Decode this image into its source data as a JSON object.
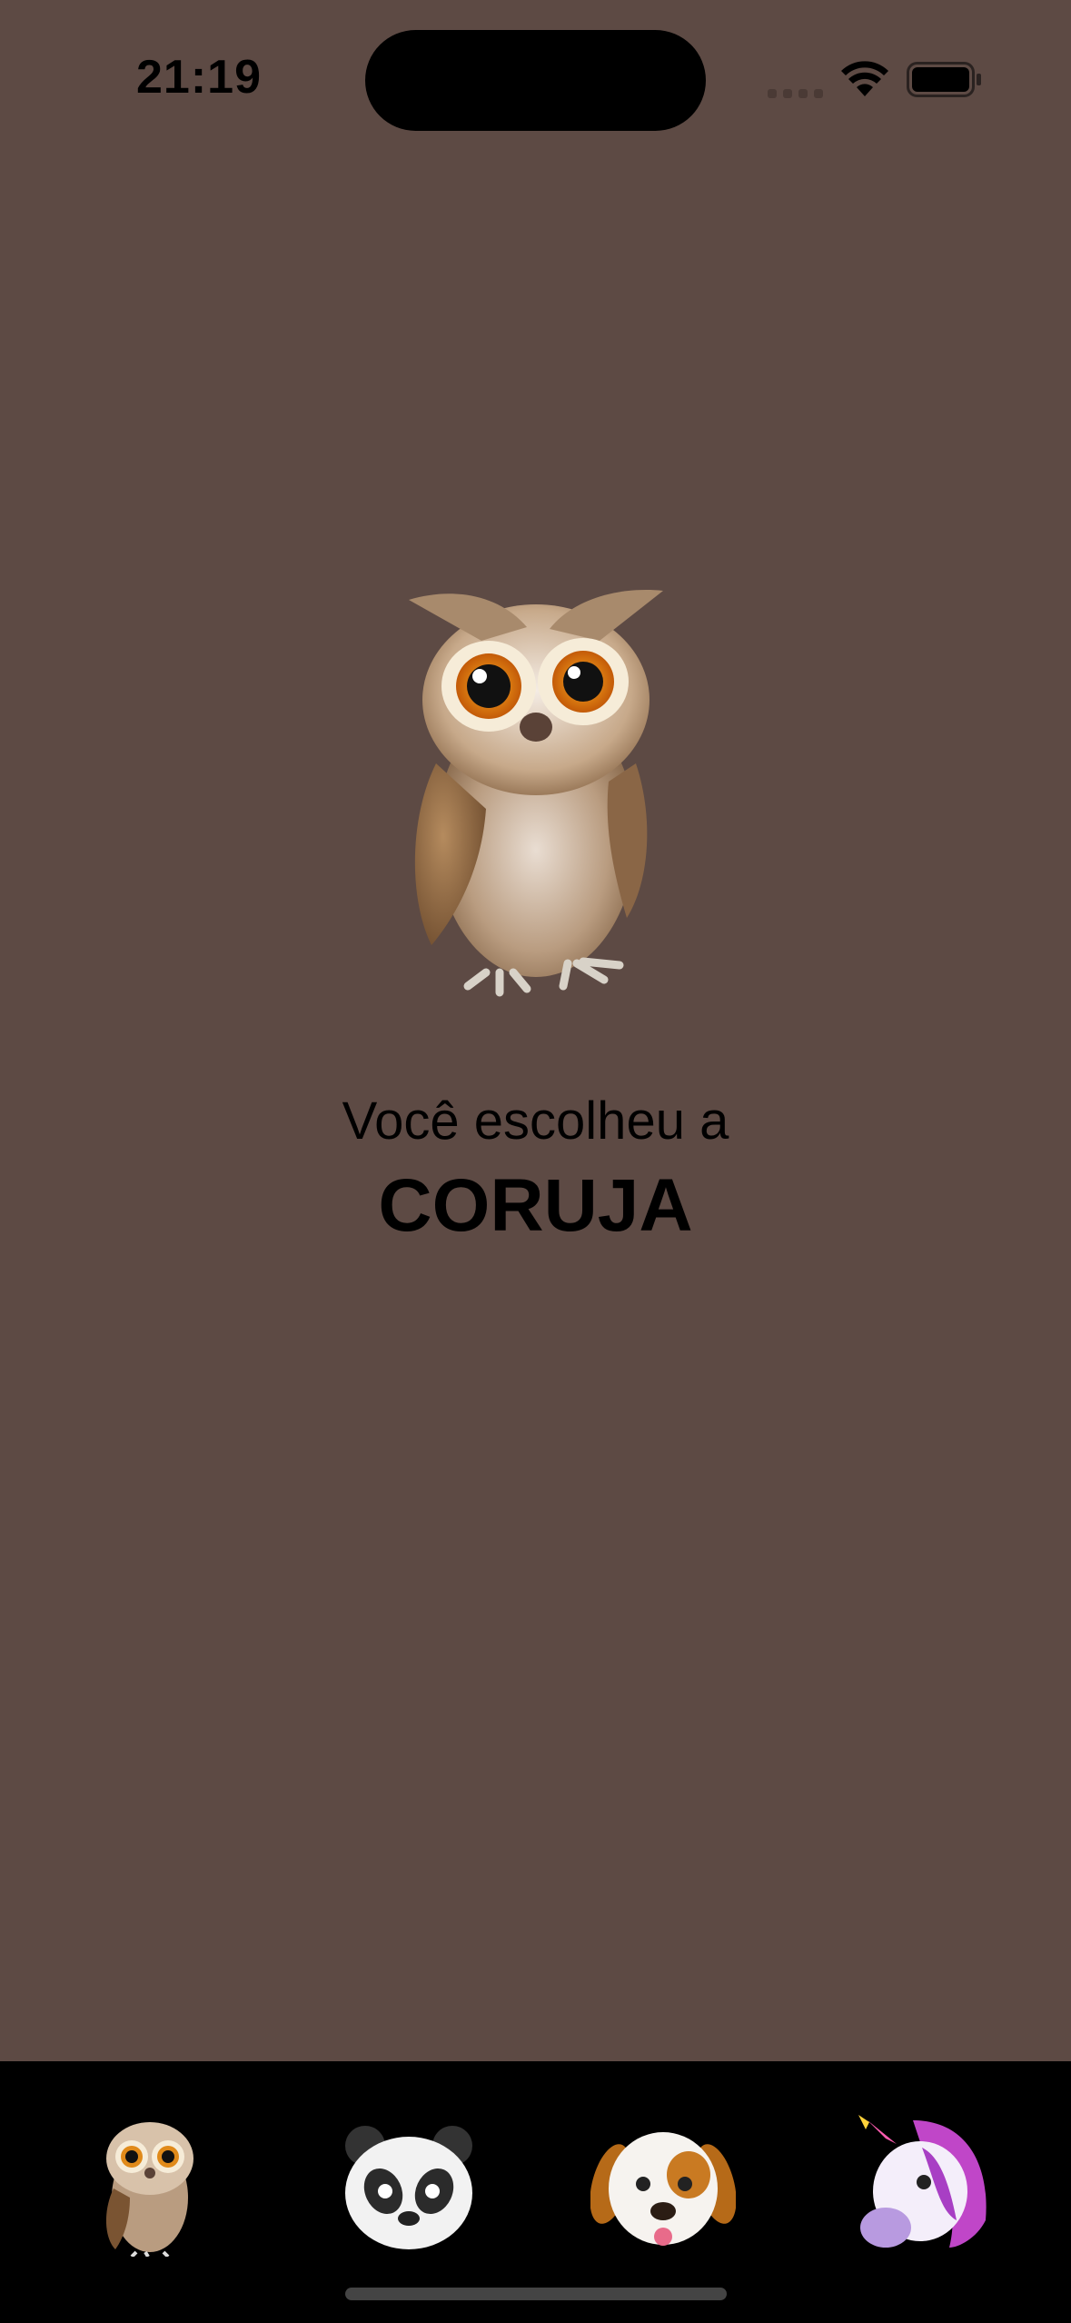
{
  "status": {
    "time": "21:19"
  },
  "hero": {
    "icon": "owl-icon",
    "label": "Você escolheu a",
    "animal": "CORUJA"
  },
  "tabs": [
    {
      "icon": "owl-icon"
    },
    {
      "icon": "panda-icon"
    },
    {
      "icon": "dog-icon"
    },
    {
      "icon": "unicorn-icon"
    }
  ],
  "colors": {
    "background": "#5d4a44",
    "tab_bar": "#000000"
  }
}
